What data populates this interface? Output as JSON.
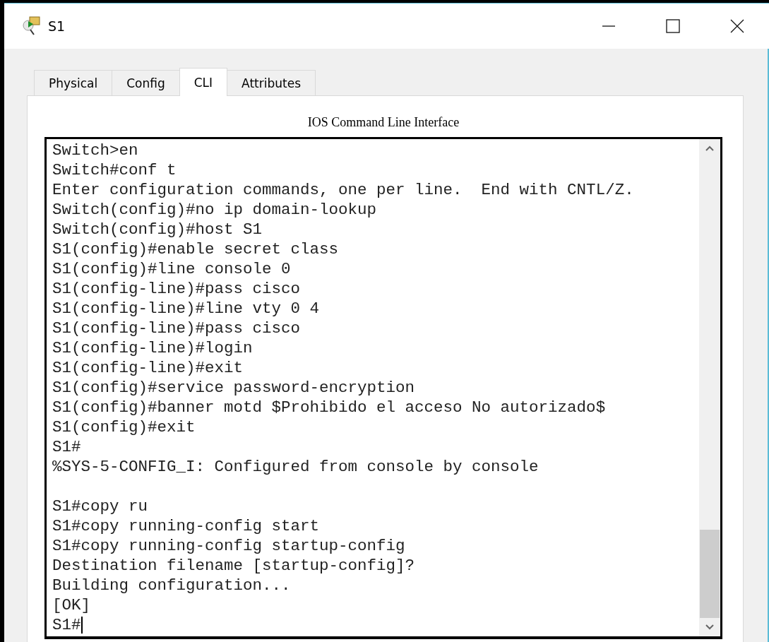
{
  "window": {
    "title": "S1"
  },
  "tabs": [
    {
      "label": "Physical",
      "selected": false
    },
    {
      "label": "Config",
      "selected": false
    },
    {
      "label": "CLI",
      "selected": true
    },
    {
      "label": "Attributes",
      "selected": false
    }
  ],
  "panel": {
    "heading": "IOS Command Line Interface"
  },
  "terminal": {
    "lines": [
      {
        "text": "Switch>en"
      },
      {
        "text": "Switch#conf t"
      },
      {
        "text": "Enter configuration commands, one per line.  End with CNTL/Z."
      },
      {
        "text": "Switch(config)#no ip domain-lookup"
      },
      {
        "text": "Switch(config)#host S1"
      },
      {
        "text": "S1(config)#enable secret class"
      },
      {
        "text": "S1(config)#line console 0"
      },
      {
        "text": "S1(config-line)#pass cisco"
      },
      {
        "text": "S1(config-line)#line vty 0 4"
      },
      {
        "text": "S1(config-line)#pass cisco"
      },
      {
        "text": "S1(config-line)#login"
      },
      {
        "text": "S1(config-line)#exit"
      },
      {
        "text": "S1(config)#service password-encryption"
      },
      {
        "text": "S1(config)#banner motd $Prohibido el acceso No autorizado$"
      },
      {
        "text": "S1(config)#exit"
      },
      {
        "text": "S1#"
      },
      {
        "text": "%SYS-5-CONFIG_I: Configured from console by console"
      },
      {
        "text": "S1#copy ru",
        "blank_before": true
      },
      {
        "text": "S1#copy running-config start"
      },
      {
        "text": "S1#copy running-config startup-config"
      },
      {
        "text": "Destination filename [startup-config]?"
      },
      {
        "text": "Building configuration..."
      },
      {
        "text": "[OK]"
      },
      {
        "text": "S1#",
        "cursor": true
      }
    ]
  }
}
